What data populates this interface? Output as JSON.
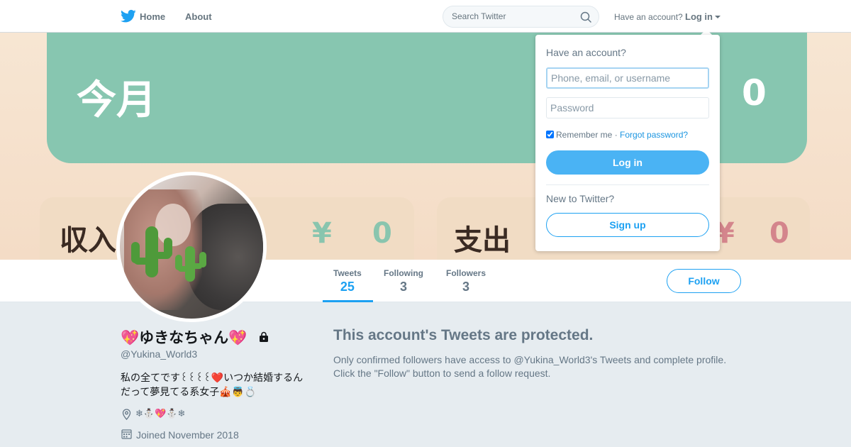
{
  "header": {
    "home_label": "Home",
    "about_label": "About",
    "search_placeholder": "Search Twitter",
    "have_account": "Have an account?",
    "login_label": "Log in"
  },
  "banner": {
    "month_label": "今月",
    "zero_top": "0",
    "income_label": "収入",
    "income_yen": "¥",
    "income_value": "0",
    "expense_label": "支出",
    "expense_yen": "¥",
    "expense_value": "0"
  },
  "stats": {
    "tweets_label": "Tweets",
    "tweets_value": "25",
    "following_label": "Following",
    "following_value": "3",
    "followers_label": "Followers",
    "followers_value": "3",
    "follow_button": "Follow"
  },
  "profile": {
    "name": "💖ゆきなちゃん💖",
    "handle": "@Yukina_World3",
    "bio": "私の全てです꒰꒰꒰꒰❤️いつか結婚するんだって夢見てる系女子🎪👼💍",
    "location": "❄⛄💖⛄❄",
    "joined": "Joined November 2018"
  },
  "protected": {
    "title": "This account's Tweets are protected.",
    "body": "Only confirmed followers have access to @Yukina_World3's Tweets and complete profile. Click the \"Follow\" button to send a follow request."
  },
  "login_dropdown": {
    "title": "Have an account?",
    "username_placeholder": "Phone, email, or username",
    "password_placeholder": "Password",
    "remember_label": "Remember me",
    "separator": " · ",
    "forgot_label": "Forgot password?",
    "login_button": "Log in",
    "new_label": "New to Twitter?",
    "signup_button": "Sign up"
  },
  "colors": {
    "accent": "#1da1f2",
    "banner_green": "#87c6b0",
    "page_bg": "#e6ecf0"
  }
}
